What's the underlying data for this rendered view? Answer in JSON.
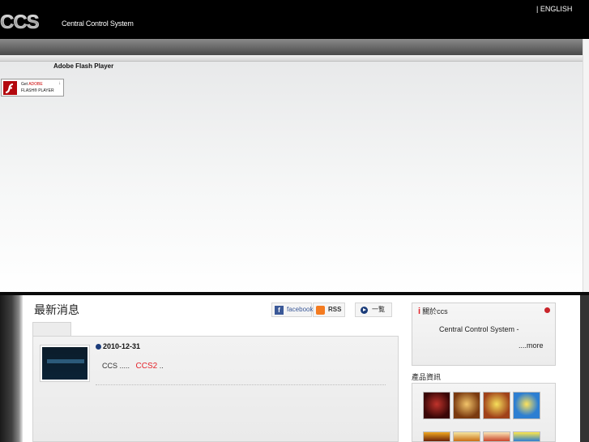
{
  "header": {
    "logo_text": "CCS",
    "subtitle": "Central Control System",
    "language_link": "| ENGLISH"
  },
  "flash": {
    "title": "Adobe Flash Player",
    "badge_get": "Get",
    "badge_adobe": "ADOBE",
    "badge_player": "FLASH® PLAYER"
  },
  "news": {
    "title": "最新消息",
    "facebook_label": "facebook",
    "rss_label": "RSS",
    "list_label": "一覧",
    "item": {
      "date": "2010-12-31",
      "prefix": "CCS   .....",
      "highlight": "CCS2",
      "suffix": ".."
    }
  },
  "about": {
    "title": "關於ccs",
    "body": "Central Control System -",
    "more": "....more"
  },
  "products": {
    "title": "產品資訊"
  },
  "colors": {
    "accent_red": "#e4232a",
    "header_bg": "#000000",
    "link_blue": "#1b3c7a"
  }
}
